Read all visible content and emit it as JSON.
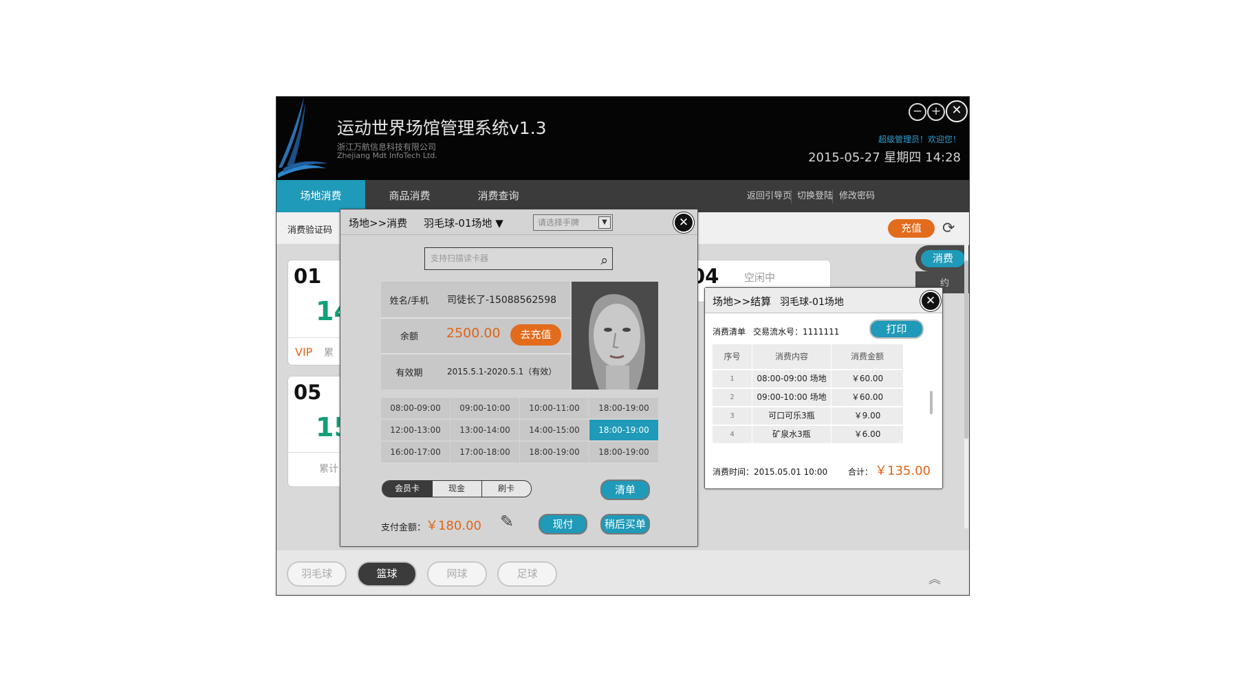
{
  "app": {
    "title": "运动世界场馆管理系统v1.3",
    "company_cn": "浙江万航信息科技有限公司",
    "company_en": "Zhejiang Mdt InfoTech Ltd.",
    "welcome": "超级管理员！欢迎您！",
    "datetime": "2015-05-27 星期四 14:28",
    "window_controls": {
      "minimize": "−",
      "maximize": "+",
      "close": "✕"
    }
  },
  "nav": {
    "tabs": [
      {
        "label": "场地消费",
        "active": true
      },
      {
        "label": "商品消费",
        "active": false
      },
      {
        "label": "消费查询",
        "active": false
      }
    ],
    "links": [
      "返回引导页",
      "切换登陆",
      "修改密码"
    ]
  },
  "toolbar": {
    "code_label": "消费验证码",
    "recharge": "充值",
    "refresh_icon": "refresh-icon"
  },
  "cards": [
    {
      "no": "01",
      "big": "14",
      "vip": "VIP",
      "extra": "累"
    },
    {
      "no": "04",
      "status": "空闲中"
    },
    {
      "no": "05",
      "big": "15",
      "foot": "累计"
    }
  ],
  "side_pay": {
    "label": "消费",
    "sub": "约"
  },
  "sports": [
    {
      "label": "羽毛球",
      "active": false
    },
    {
      "label": "篮球",
      "active": true
    },
    {
      "label": "网球",
      "active": false
    },
    {
      "label": "足球",
      "active": false
    }
  ],
  "modal1": {
    "crumb": "场地>>消费",
    "venue": "羽毛球-01场地 ▼",
    "select_placeholder": "请选择手牌",
    "scan_placeholder": "支持扫描读卡器",
    "name_label": "姓名/手机",
    "name_value": "司徒长了-15088562598",
    "balance_label": "余额",
    "balance_value": "2500.00",
    "recharge_btn": "去充值",
    "validity_label": "有效期",
    "validity_value": "2015.5.1-2020.5.1（有效）",
    "slots": [
      [
        "08:00-09:00",
        "09:00-10:00",
        "10:00-11:00",
        "18:00-19:00"
      ],
      [
        "12:00-13:00",
        "13:00-14:00",
        "14:00-15:00",
        "18:00-19:00"
      ],
      [
        "16:00-17:00",
        "17:00-18:00",
        "18:00-19:00",
        "18:00-19:00"
      ]
    ],
    "active_slot": {
      "row": 1,
      "col": 3
    },
    "pay_types": [
      "会员卡",
      "现金",
      "刷卡"
    ],
    "active_pay_type": 0,
    "list_btn": "清单",
    "pay_label": "支付金额：",
    "pay_amount": "￥180.00",
    "pay_now": "现付",
    "pay_later": "稍后买单"
  },
  "modal2": {
    "crumb": "场地>>结算",
    "venue": "羽毛球-01场地",
    "bill_label": "消费清单",
    "serial_label": "交易流水号：1111111",
    "print_btn": "打印",
    "columns": [
      "序号",
      "消费内容",
      "消费金额"
    ],
    "rows": [
      [
        "1",
        "08:00-09:00 场地",
        "￥60.00"
      ],
      [
        "2",
        "09:00-10:00 场地",
        "￥60.00"
      ],
      [
        "3",
        "可口可乐3瓶",
        "￥9.00"
      ],
      [
        "4",
        "矿泉水3瓶",
        "￥6.00"
      ]
    ],
    "time_label": "消费时间：2015.05.01 10:00",
    "total_label": "合计：",
    "total_value": "￥135.00"
  },
  "colors": {
    "accent": "#1f9ab8",
    "orange": "#e26c1c",
    "dark": "#050505"
  }
}
